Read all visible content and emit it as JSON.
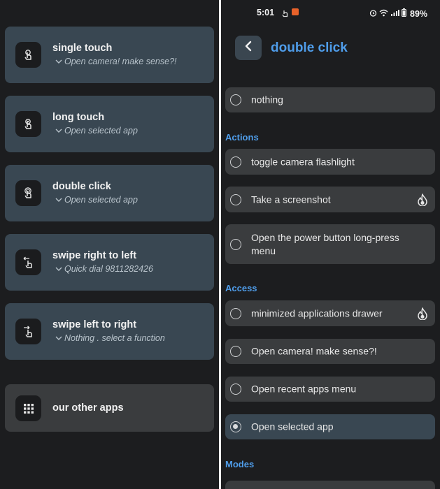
{
  "left_panel": {
    "gestures": [
      {
        "title": "single touch",
        "subtitle": "Open camera! make sense?!",
        "icon": "single-touch-icon"
      },
      {
        "title": "long touch",
        "subtitle": "Open selected app",
        "icon": "long-touch-icon"
      },
      {
        "title": "double click",
        "subtitle": "Open selected app",
        "icon": "double-click-icon"
      },
      {
        "title": "swipe right to left",
        "subtitle": "Quick dial 9811282426",
        "icon": "swipe-left-icon"
      },
      {
        "title": "swipe left to right",
        "subtitle": "Nothing . select a function",
        "icon": "swipe-right-icon"
      }
    ],
    "other_apps": {
      "title": "our other apps",
      "icon": "grid-icon"
    }
  },
  "status_bar": {
    "time": "5:01",
    "battery": "89%",
    "icons": [
      "notification-icon",
      "app-notification-icon",
      "alarm-icon",
      "wifi-icon",
      "signal-icon",
      "battery-icon"
    ]
  },
  "header": {
    "title": "double click",
    "back_icon": "back-chevron-icon"
  },
  "options": {
    "nothing": {
      "label": "nothing",
      "selected": false
    },
    "sections": [
      {
        "title": "Actions",
        "items": [
          {
            "label": "toggle camera flashlight",
            "selected": false,
            "premium": false
          },
          {
            "label": "Take a screenshot",
            "selected": false,
            "premium": true
          },
          {
            "label": "Open the power button long-press menu",
            "selected": false,
            "premium": false
          }
        ]
      },
      {
        "title": "Access",
        "items": [
          {
            "label": "minimized applications drawer",
            "selected": false,
            "premium": true
          },
          {
            "label": "Open camera! make sense?!",
            "selected": false,
            "premium": false
          },
          {
            "label": "Open recent apps menu",
            "selected": false,
            "premium": false
          },
          {
            "label": "Open selected app",
            "selected": true,
            "premium": false
          }
        ]
      },
      {
        "title": "Modes",
        "items": []
      }
    ]
  },
  "colors": {
    "background": "#1c1d1f",
    "card": "#394752",
    "option": "#3a3c3e",
    "accent": "#4f9dea",
    "premium_icon": "flame-icon"
  }
}
